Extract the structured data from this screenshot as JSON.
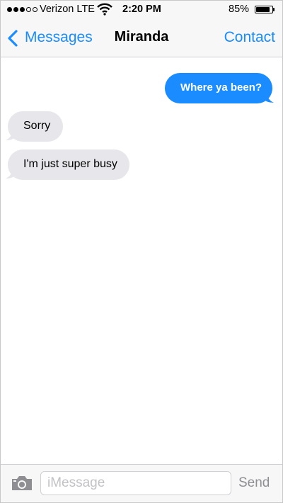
{
  "status_bar": {
    "signal_bars_filled": 3,
    "signal_bars_total": 5,
    "carrier": "Verizon LTE",
    "wifi_icon": "wifi-icon",
    "time": "2:20 PM",
    "battery_percent": "85%",
    "battery_level": 0.85
  },
  "nav": {
    "back_label": "Messages",
    "title": "Miranda",
    "contact_label": "Contact"
  },
  "messages": [
    {
      "direction": "outgoing",
      "text": "Where ya been?"
    },
    {
      "direction": "incoming",
      "text": "Sorry"
    },
    {
      "direction": "incoming",
      "text": "I'm just super busy"
    }
  ],
  "input_bar": {
    "camera_icon": "camera-icon",
    "placeholder": "iMessage",
    "value": "",
    "send_label": "Send"
  },
  "colors": {
    "accent": "#1a8cff",
    "incoming_bubble": "#e6e6eb",
    "bar_background": "#f7f7f7",
    "send_disabled": "#8e8e93"
  }
}
